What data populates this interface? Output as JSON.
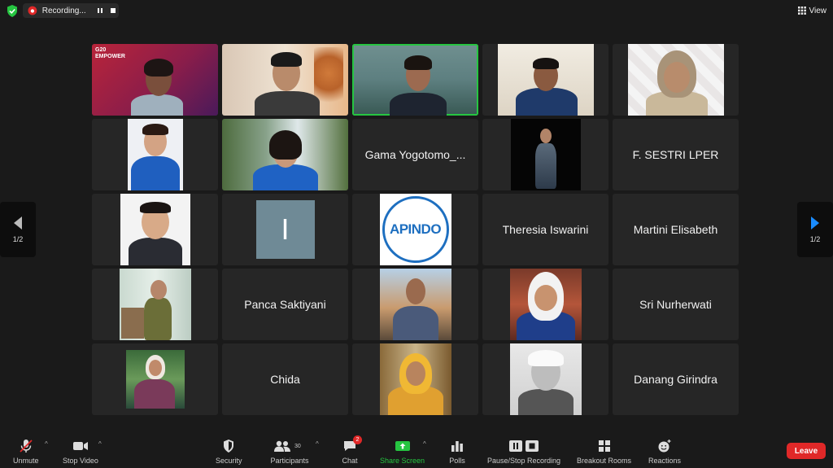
{
  "topbar": {
    "recording_label": "Recording...",
    "view_label": "View"
  },
  "page_nav": {
    "left_page": "1/2",
    "right_page": "1/2"
  },
  "tiles": [
    {
      "type": "video",
      "name": "G20 EMPOWER",
      "logo_text": "G20\nEMPOWER"
    },
    {
      "type": "video"
    },
    {
      "type": "video",
      "active": true
    },
    {
      "type": "video"
    },
    {
      "type": "video"
    },
    {
      "type": "video"
    },
    {
      "type": "video"
    },
    {
      "type": "name",
      "name": "Gama Yogotomo_..."
    },
    {
      "type": "video"
    },
    {
      "type": "name",
      "name": "F. SESTRI LPER"
    },
    {
      "type": "video"
    },
    {
      "type": "initial",
      "initial": "I"
    },
    {
      "type": "logo",
      "logo_text": "APINDO"
    },
    {
      "type": "name",
      "name": "Theresia Iswarini"
    },
    {
      "type": "name",
      "name": "Martini Elisabeth"
    },
    {
      "type": "video"
    },
    {
      "type": "name",
      "name": "Panca Saktiyani"
    },
    {
      "type": "video"
    },
    {
      "type": "video"
    },
    {
      "type": "name",
      "name": "Sri Nurherwati"
    },
    {
      "type": "video"
    },
    {
      "type": "name",
      "name": "Chida"
    },
    {
      "type": "video"
    },
    {
      "type": "video"
    },
    {
      "type": "name",
      "name": "Danang Girindra"
    }
  ],
  "toolbar": {
    "unmute": "Unmute",
    "stop_video": "Stop Video",
    "security": "Security",
    "participants": "Participants",
    "participants_count": "30",
    "chat": "Chat",
    "chat_badge": "2",
    "share_screen": "Share Screen",
    "polls": "Polls",
    "pause_stop_recording": "Pause/Stop Recording",
    "breakout_rooms": "Breakout Rooms",
    "reactions": "Reactions",
    "leave": "Leave"
  },
  "colors": {
    "background": "#1a1a1a",
    "tile": "#262626",
    "active_speaker": "#26c541",
    "leave": "#e02828",
    "nav_arrow": "#1a8cff"
  }
}
